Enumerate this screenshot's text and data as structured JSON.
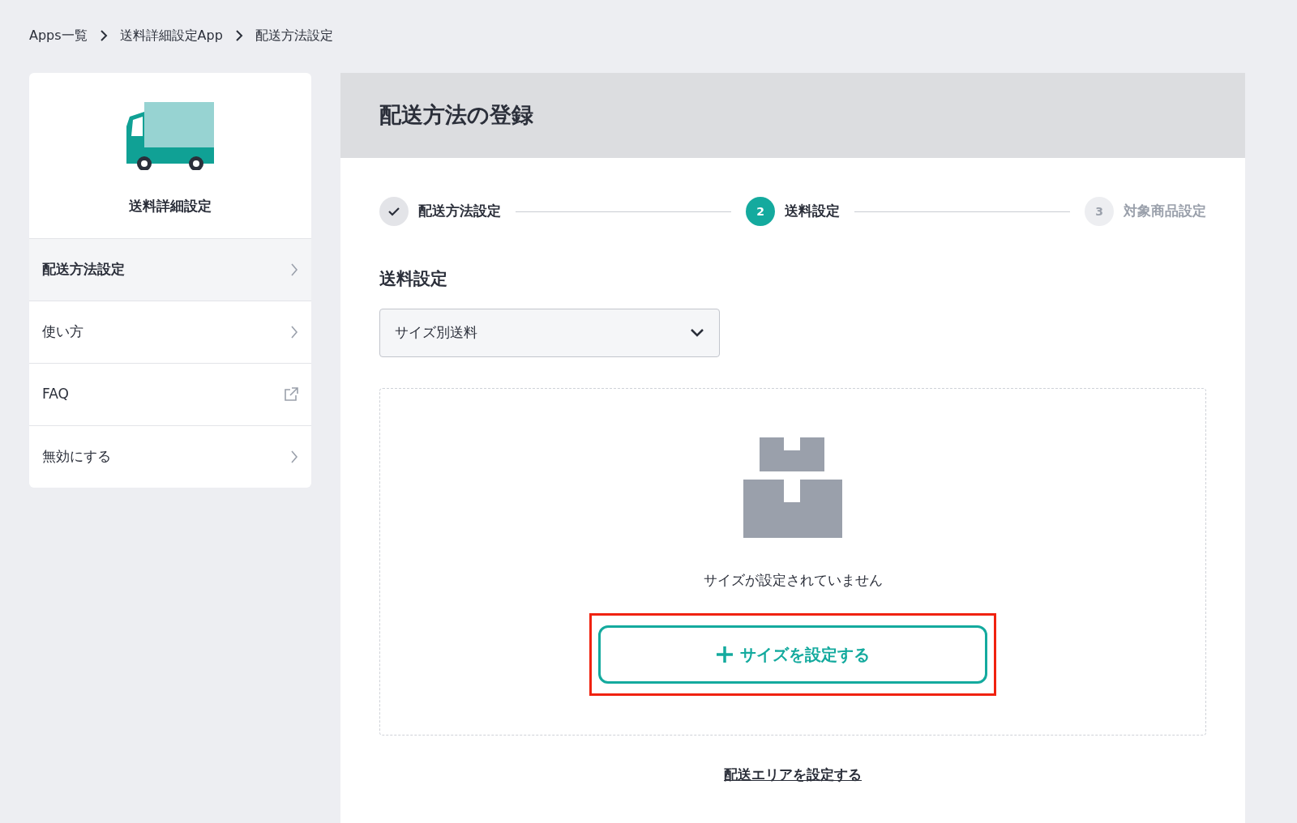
{
  "breadcrumb": [
    {
      "label": "Apps一覧"
    },
    {
      "label": "送料詳細設定App"
    },
    {
      "label": "配送方法設定"
    }
  ],
  "sidebar": {
    "title": "送料詳細設定",
    "items": [
      {
        "label": "配送方法設定",
        "selected": true,
        "kind": "page"
      },
      {
        "label": "使い方",
        "selected": false,
        "kind": "page"
      },
      {
        "label": "FAQ",
        "selected": false,
        "kind": "external"
      },
      {
        "label": "無効にする",
        "selected": false,
        "kind": "page"
      }
    ]
  },
  "main": {
    "title": "配送方法の登録",
    "steps": [
      {
        "label": "配送方法設定",
        "completed": true,
        "selected": false
      },
      {
        "number": "2",
        "label": "送料設定",
        "completed": false,
        "selected": true
      },
      {
        "number": "3",
        "label": "対象商品設定",
        "completed": false,
        "selected": false
      }
    ],
    "section_title": "送料設定",
    "select": {
      "value": "サイズ別送料"
    },
    "empty_state": {
      "message": "サイズが設定されていません",
      "button": {
        "label": "サイズを設定する",
        "highlighted": true
      }
    },
    "link": "配送エリアを設定する"
  }
}
